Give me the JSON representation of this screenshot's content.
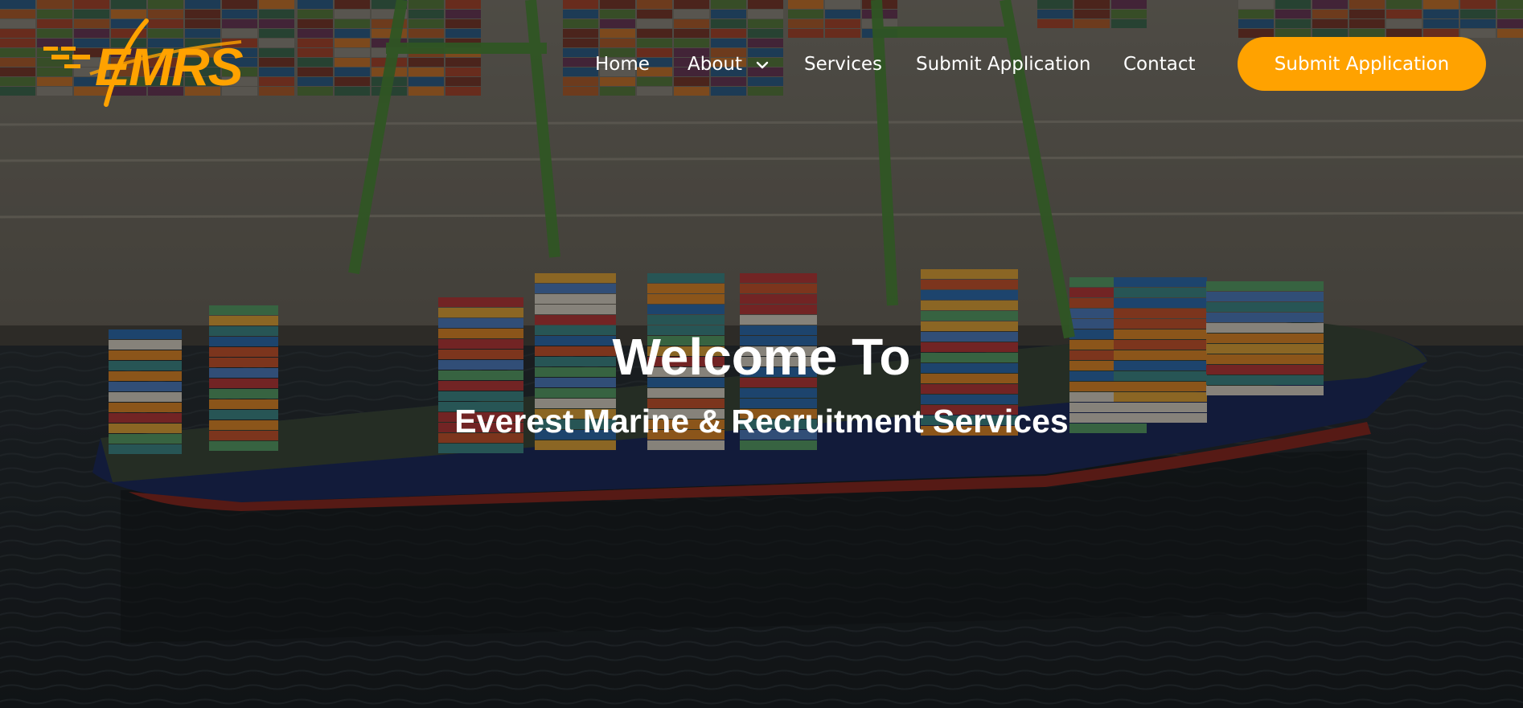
{
  "brand": {
    "logo_text": "EMRS",
    "accent_color": "#ffa200",
    "logo_icon": "swoosh-icon"
  },
  "nav": {
    "items": [
      {
        "label": "Home",
        "has_dropdown": false
      },
      {
        "label": "About",
        "has_dropdown": true
      },
      {
        "label": "Services",
        "has_dropdown": false
      },
      {
        "label": "Submit Application",
        "has_dropdown": false
      },
      {
        "label": "Contact",
        "has_dropdown": false
      }
    ],
    "dropdown_icon": "chevron-down-icon",
    "cta_label": "Submit Application"
  },
  "hero": {
    "title": "Welcome To",
    "subtitle": "Everest Marine & Recruitment Services",
    "background": "container-ship-at-port-aerial"
  }
}
